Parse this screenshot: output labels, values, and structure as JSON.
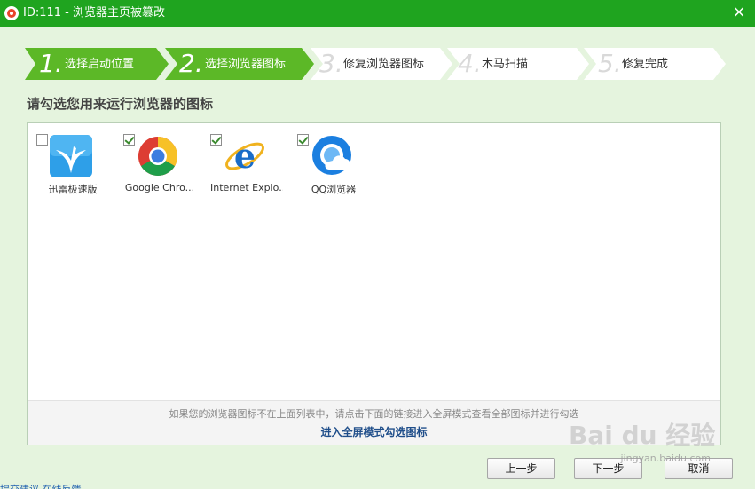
{
  "window": {
    "title": "ID:111 - 浏览器主页被篡改",
    "close_glyph": "×"
  },
  "steps": [
    {
      "num": "1.",
      "label": "选择启动位置",
      "state": "done"
    },
    {
      "num": "2.",
      "label": "选择浏览器图标",
      "state": "current"
    },
    {
      "num": "3.",
      "label": "修复浏览器图标",
      "state": "pending"
    },
    {
      "num": "4.",
      "label": "木马扫描",
      "state": "pending"
    },
    {
      "num": "5.",
      "label": "修复完成",
      "state": "pending"
    }
  ],
  "prompt": "请勾选您用来运行浏览器的图标",
  "icons": [
    {
      "name": "迅雷极速版",
      "checked": false,
      "icon": "thunder-icon"
    },
    {
      "name": "Google Chro...",
      "checked": true,
      "icon": "chrome-icon"
    },
    {
      "name": "Internet Explo...",
      "checked": true,
      "icon": "ie-icon"
    },
    {
      "name": "QQ浏览器",
      "checked": true,
      "icon": "qq-browser-icon"
    }
  ],
  "footer": {
    "hint": "如果您的浏览器图标不在上面列表中，请点击下面的链接进入全屏模式查看全部图标并进行勾选",
    "link": "进入全屏模式勾选图标"
  },
  "buttons": {
    "prev": "上一步",
    "next": "下一步",
    "cancel": "取消"
  },
  "bottom_link": "提交建议  在线反馈",
  "watermark": {
    "logo": "Bai du 经验",
    "url": "jingyan.baidu.com"
  },
  "colors": {
    "titlebar": "#1fa41f",
    "step_active": "#5cb827",
    "step_inactive": "#ffffff",
    "background": "#e5f4de"
  }
}
